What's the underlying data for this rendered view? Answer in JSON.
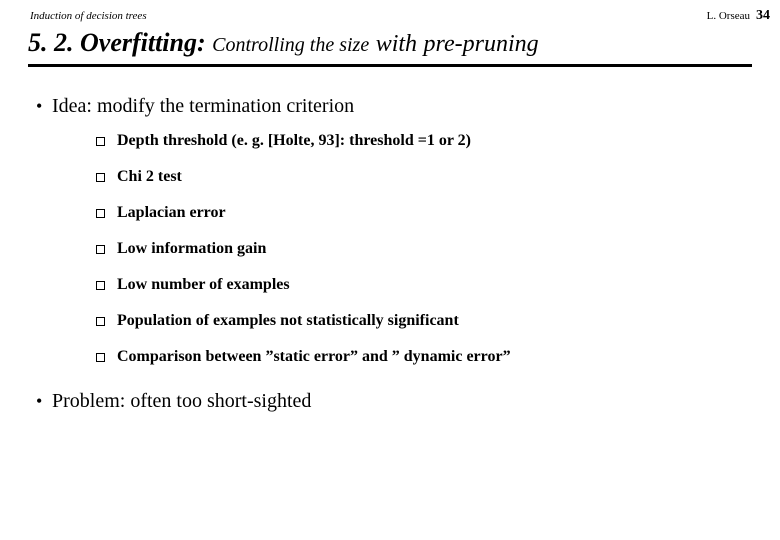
{
  "header": {
    "left": "Induction of decision trees",
    "right": "L. Orseau",
    "page_number": "34"
  },
  "title": {
    "section": "5. 2.",
    "keyword": " Overfitting:",
    "subtitle": " Controlling the size",
    "connector": " with",
    "method": " pre-pruning"
  },
  "body": {
    "idea": "Idea: modify the termination criterion",
    "subitems": [
      "Depth threshold (e. g. [Holte, 93]: threshold =1 or 2)",
      "Chi 2 test",
      "Laplacian error",
      "Low information gain",
      "Low number of examples",
      "Population of examples not statistically significant",
      "Comparison between ”static error” and ” dynamic error”"
    ],
    "problem": "Problem: often too short-sighted"
  }
}
